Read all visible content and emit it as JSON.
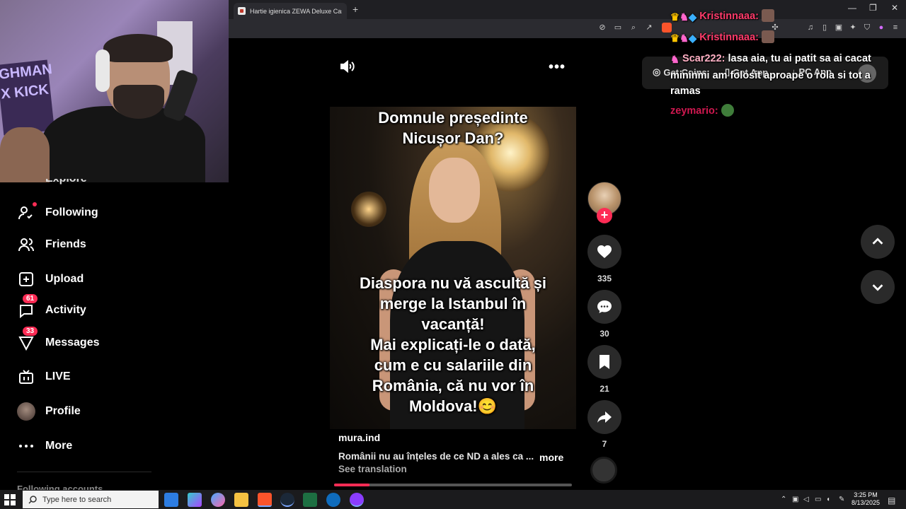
{
  "browser": {
    "tab_title": "Hartie igienica ZEWA Deluxe Cashmere",
    "new_tab": "+",
    "minimize": "—",
    "restore": "❐",
    "close": "✕"
  },
  "webcam": {
    "sign_text": "GHMAN X KICK"
  },
  "sidebar": {
    "explore_partial": "Explore",
    "items": [
      {
        "label": "Following",
        "icon": "following-icon"
      },
      {
        "label": "Friends",
        "icon": "friends-icon"
      },
      {
        "label": "Upload",
        "icon": "upload-icon"
      },
      {
        "label": "Activity",
        "icon": "activity-icon",
        "badge": "61"
      },
      {
        "label": "Messages",
        "icon": "messages-icon",
        "badge": "33"
      },
      {
        "label": "LIVE",
        "icon": "live-icon"
      },
      {
        "label": "Profile",
        "icon": "profile-avatar"
      },
      {
        "label": "More",
        "icon": "more-icon"
      }
    ],
    "following_accounts": "Following accounts"
  },
  "video": {
    "title_overlay_line1": "Domnule președinte",
    "title_overlay_line2": "Nicușor Dan?",
    "body_overlay": [
      "Diaspora nu vă ascultă și",
      "merge la Istanbul în",
      "vacanță!",
      "Mai explicați-le o dată,",
      "cum e cu salariile din",
      "România, că nu vor în",
      "Moldova!😊"
    ],
    "author": "mura.ind",
    "description": "Românii nu au înțeles de ce ND a ales ca ...",
    "more_link": "more",
    "see_translation": "See translation",
    "progress": 0.15
  },
  "actions": {
    "likes": "335",
    "comments": "30",
    "saves": "21",
    "shares": "7"
  },
  "header": {
    "get_coins": "Get Coins",
    "get_app": "Get App",
    "pc_app": "PC App"
  },
  "chat": [
    {
      "name": "Kristinnaaa:",
      "message": ""
    },
    {
      "name": "Kristinnaaa:",
      "message": ""
    },
    {
      "name": "Scar222:",
      "message": "lasa aia, tu ai patit sa ai cacat mininmi am folosit aproape o rola si tot a ramas"
    },
    {
      "name": "zeymario:",
      "message": ""
    }
  ],
  "taskbar": {
    "search_placeholder": "Type here to search",
    "time": "3:25 PM",
    "date": "8/13/2025"
  },
  "colors": {
    "accent": "#fe2c55",
    "background": "#000000"
  }
}
